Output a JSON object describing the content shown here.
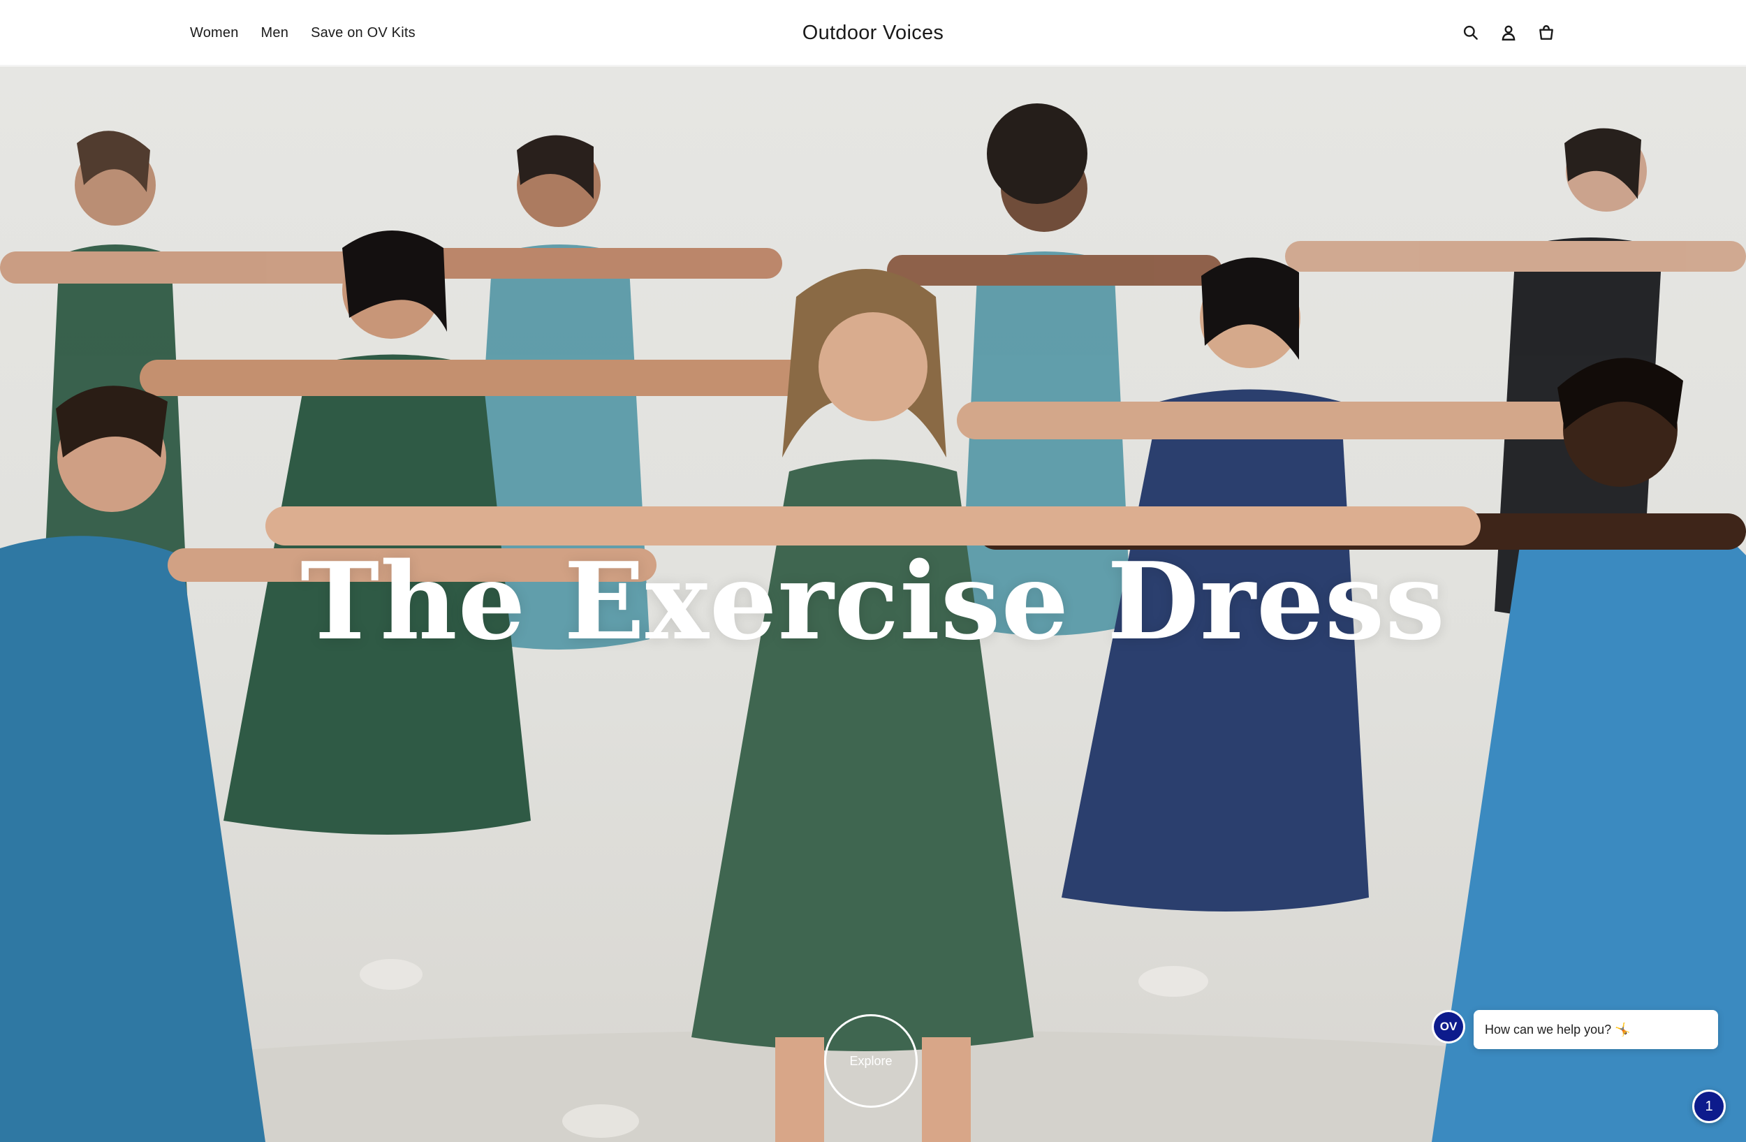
{
  "header": {
    "nav_left": [
      {
        "label": "Women"
      },
      {
        "label": "Men"
      },
      {
        "label": "Save on OV Kits"
      }
    ],
    "brand": "Outdoor Voices",
    "icons": [
      "search-icon",
      "account-icon",
      "cart-icon"
    ]
  },
  "hero": {
    "title": "The Exercise Dress",
    "explore_label": "Explore"
  },
  "chat": {
    "avatar_text": "OV",
    "prompt": "How can we help you? 🤸",
    "badge_count": "1"
  },
  "colors": {
    "brand_navy": "#0d1b8c",
    "dress_green": "#3f6650",
    "dress_teal": "#5a9aa8",
    "dress_blue": "#2f78a3",
    "dress_navy": "#2b3f6e",
    "backdrop": "#e3e3df"
  }
}
